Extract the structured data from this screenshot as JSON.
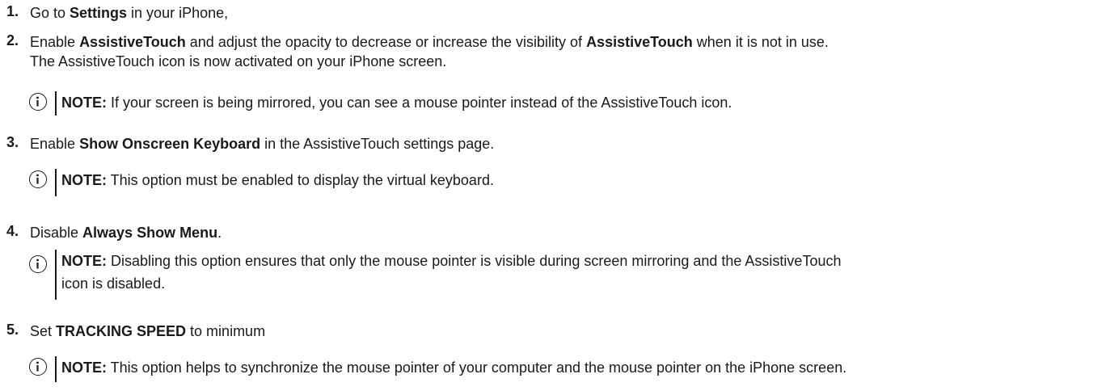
{
  "steps": [
    {
      "num": "1.",
      "pre": "Go to ",
      "bold": "Settings",
      "post": " in your iPhone,"
    },
    {
      "num": "2.",
      "pre": "Enable ",
      "bold": "AssistiveTouch",
      "mid": " and adjust the opacity to decrease or increase the visibility of ",
      "bold2": "AssistiveTouch",
      "post": " when it is not in use.",
      "line2": "The AssistiveTouch icon is now activated on your iPhone screen.",
      "note": {
        "label": "NOTE:",
        "text": " If your screen is being mirrored, you can see a mouse pointer instead of the AssistiveTouch icon."
      }
    },
    {
      "num": "3.",
      "pre": "Enable ",
      "bold": "Show Onscreen Keyboard",
      "post": " in the AssistiveTouch settings page.",
      "note": {
        "label": "NOTE:",
        "text": " This option must be enabled to display the virtual keyboard."
      }
    },
    {
      "num": "4.",
      "pre": "Disable ",
      "bold": "Always Show Menu",
      "post": ".",
      "note": {
        "label": "NOTE:",
        "text": " Disabling this option ensures that only the mouse pointer is visible during screen mirroring and the AssistiveTouch",
        "line2": "icon is disabled."
      }
    },
    {
      "num": "5.",
      "pre": "Set ",
      "bold": "TRACKING SPEED",
      "post": " to minimum",
      "note": {
        "label": "NOTE:",
        "text": " This option helps to synchronize the mouse pointer of your computer and the mouse pointer on the iPhone screen."
      }
    }
  ],
  "icons": {
    "note": "info-icon"
  }
}
